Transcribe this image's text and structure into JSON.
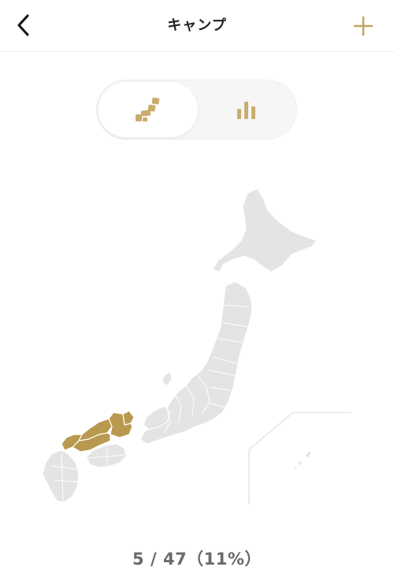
{
  "header": {
    "title": "キャンプ",
    "back_icon": "chevron-left-icon",
    "add_icon": "plus-icon"
  },
  "segment": {
    "selected": "map",
    "items": [
      {
        "id": "map",
        "icon": "japan-map-icon"
      },
      {
        "id": "stats",
        "icon": "bar-chart-icon"
      }
    ]
  },
  "progress": {
    "visited": 5,
    "total": 47,
    "label": "5 / 47（11%）"
  },
  "colors": {
    "accent": "#c4a561",
    "visited_fill": "#b9994f",
    "unvisited_fill": "#e4e4e4",
    "text": "#222222",
    "count_text": "#6a6a6a"
  }
}
